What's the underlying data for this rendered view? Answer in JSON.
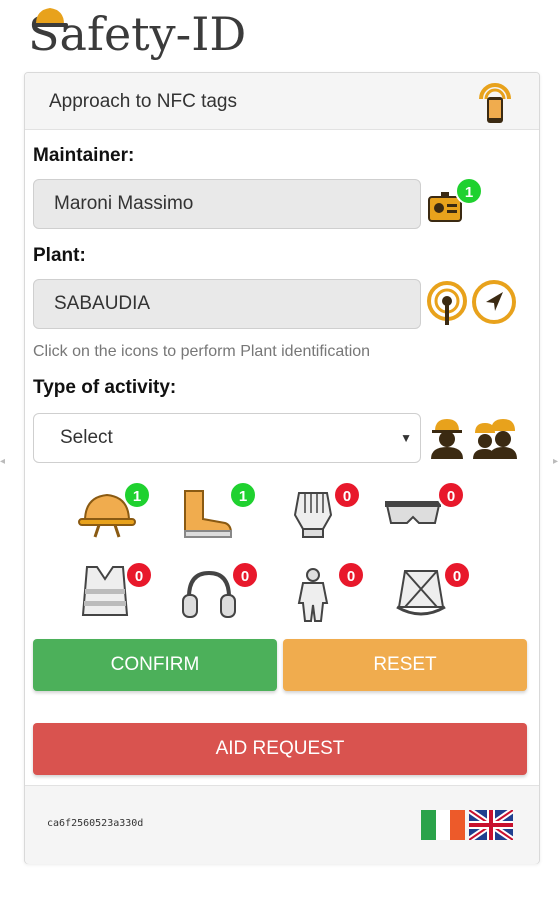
{
  "app": {
    "logo_text": "Safety-ID"
  },
  "header": {
    "title": "Approach to NFC tags"
  },
  "maintainer": {
    "label": "Maintainer:",
    "value": "Maroni Massimo",
    "badge": "1"
  },
  "plant": {
    "label": "Plant:",
    "value": "SABAUDIA",
    "hint": "Click on the icons to perform Plant identification"
  },
  "activity": {
    "label": "Type of activity:",
    "selected": "Select"
  },
  "ppe": [
    {
      "name": "helmet",
      "count": "1",
      "status": "green"
    },
    {
      "name": "boots",
      "count": "1",
      "status": "green"
    },
    {
      "name": "gloves",
      "count": "0",
      "status": "red"
    },
    {
      "name": "goggles",
      "count": "0",
      "status": "red"
    },
    {
      "name": "vest",
      "count": "0",
      "status": "red"
    },
    {
      "name": "earmuffs",
      "count": "0",
      "status": "red"
    },
    {
      "name": "coverall",
      "count": "0",
      "status": "red"
    },
    {
      "name": "harness",
      "count": "0",
      "status": "red"
    }
  ],
  "buttons": {
    "confirm": "CONFIRM",
    "reset": "RESET",
    "aid": "AID REQUEST"
  },
  "footer": {
    "code": "ca6f2560523a330d",
    "languages": [
      "it-flag",
      "uk-flag"
    ]
  },
  "colors": {
    "accent_orange": "#f0ac4e",
    "confirm_green": "#4cb05a",
    "aid_red": "#d9534f",
    "badge_green": "#1fd12f",
    "badge_red": "#e8182b",
    "icon_gold": "#e8a21c"
  }
}
